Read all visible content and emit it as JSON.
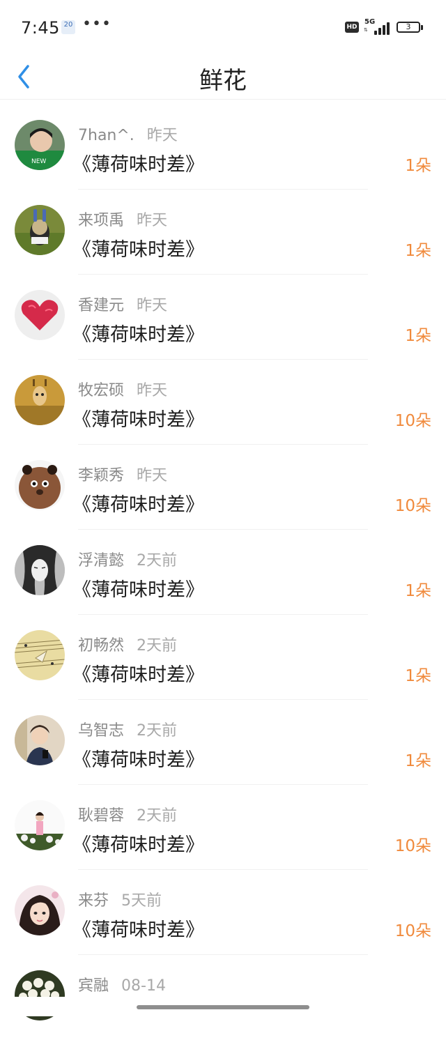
{
  "status_bar": {
    "time": "7:45",
    "calendar_day": "20",
    "network": "5G",
    "hd_label": "HD",
    "battery": "3"
  },
  "header": {
    "title": "鲜花"
  },
  "colors": {
    "accent_blue": "#2f8fe6",
    "count_orange": "#f08a3c"
  },
  "records": [
    {
      "name": "7han^.",
      "time": "昨天",
      "book": "《薄荷味时差》",
      "count": "1朵"
    },
    {
      "name": "来项禹",
      "time": "昨天",
      "book": "《薄荷味时差》",
      "count": "1朵"
    },
    {
      "name": "香建元",
      "time": "昨天",
      "book": "《薄荷味时差》",
      "count": "1朵"
    },
    {
      "name": "牧宏硕",
      "time": "昨天",
      "book": "《薄荷味时差》",
      "count": "10朵"
    },
    {
      "name": "李颖秀",
      "time": "昨天",
      "book": "《薄荷味时差》",
      "count": "10朵"
    },
    {
      "name": "浮清懿",
      "time": "2天前",
      "book": "《薄荷味时差》",
      "count": "1朵"
    },
    {
      "name": "初畅然",
      "time": "2天前",
      "book": "《薄荷味时差》",
      "count": "1朵"
    },
    {
      "name": "乌智志",
      "time": "2天前",
      "book": "《薄荷味时差》",
      "count": "1朵"
    },
    {
      "name": "耿碧蓉",
      "time": "2天前",
      "book": "《薄荷味时差》",
      "count": "10朵"
    },
    {
      "name": "来芬",
      "time": "5天前",
      "book": "《薄荷味时差》",
      "count": "10朵"
    },
    {
      "name": "宾融",
      "time": "08-14",
      "book": "",
      "count": ""
    }
  ]
}
